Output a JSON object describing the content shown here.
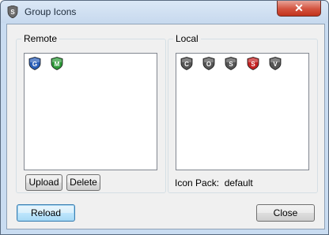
{
  "window": {
    "title": "Group Icons"
  },
  "remote": {
    "label": "Remote",
    "icons": [
      {
        "letter": "G",
        "color": "#2b5fb8",
        "name": "g"
      },
      {
        "letter": "M",
        "color": "#2f9a3a",
        "name": "m"
      }
    ],
    "upload_label": "Upload",
    "delete_label": "Delete"
  },
  "local": {
    "label": "Local",
    "icons": [
      {
        "letter": "C",
        "color": "#555555",
        "name": "c"
      },
      {
        "letter": "O",
        "color": "#555555",
        "name": "o"
      },
      {
        "letter": "S",
        "color": "#555555",
        "name": "s-gray"
      },
      {
        "letter": "S",
        "color": "#c42424",
        "name": "s-red"
      },
      {
        "letter": "V",
        "color": "#555555",
        "name": "v"
      }
    ],
    "pack_label": "Icon Pack:",
    "pack_value": "default"
  },
  "buttons": {
    "reload": "Reload",
    "close": "Close"
  }
}
